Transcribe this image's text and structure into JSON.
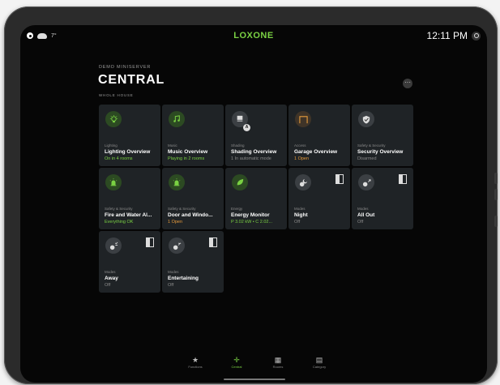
{
  "status_bar": {
    "temperature": "7°",
    "brand": "LOXONE",
    "time": "12:11 PM"
  },
  "header": {
    "server": "DEMO MINISERVER",
    "title": "CENTRAL",
    "subtitle": "WHOLE HOUSE",
    "more_label": "···"
  },
  "tiles": [
    {
      "category": "Lighting",
      "name": "Lighting Overview",
      "status": "On in 4 rooms",
      "icon": "lightbulb-icon",
      "status_color": "green"
    },
    {
      "category": "Music",
      "name": "Music Overview",
      "status": "Playing in 2 rooms",
      "icon": "music-note-icon",
      "status_color": "green"
    },
    {
      "category": "Shading",
      "name": "Shading Overview",
      "status": "1 In automatic mode",
      "icon": "blind-icon",
      "status_color": "gray",
      "badge": "A"
    },
    {
      "category": "Access",
      "name": "Garage Overview",
      "status": "1 Open",
      "icon": "garage-door-icon",
      "status_color": "orange"
    },
    {
      "category": "Safety & Security",
      "name": "Security Overview",
      "status": "Disarmed",
      "icon": "shield-icon",
      "status_color": "gray"
    },
    {
      "category": "Safety & Security",
      "name": "Fire and Water Al...",
      "status": "Everything OK",
      "icon": "siren-icon",
      "status_color": "green"
    },
    {
      "category": "Safety & Security",
      "name": "Door and Windo...",
      "status": "1 Open",
      "icon": "siren-icon",
      "status_color": "orange"
    },
    {
      "category": "Energy",
      "name": "Energy Monitor",
      "status": "P 3.02 kW • C 2.02...",
      "icon": "leaf-icon",
      "status_color": "green"
    },
    {
      "category": "Modes",
      "name": "Night",
      "status": "Off",
      "icon": "moon-mode-icon",
      "status_color": "gray",
      "toggle": true
    },
    {
      "category": "Modes",
      "name": "All Out",
      "status": "Off",
      "icon": "leave-mode-icon",
      "status_color": "gray",
      "toggle": true
    },
    {
      "category": "Modes",
      "name": "Away",
      "status": "Off",
      "icon": "away-mode-icon",
      "status_color": "gray",
      "toggle": true
    },
    {
      "category": "Modes",
      "name": "Entertaining",
      "status": "Off",
      "icon": "party-mode-icon",
      "status_color": "gray",
      "toggle": true
    }
  ],
  "bottom_nav": [
    {
      "label": "Functions",
      "icon": "star-icon",
      "glyph": "★",
      "active": false
    },
    {
      "label": "Central",
      "icon": "central-icon",
      "glyph": "✛",
      "active": true
    },
    {
      "label": "Rooms",
      "icon": "grid-icon",
      "glyph": "▦",
      "active": false
    },
    {
      "label": "Category",
      "icon": "category-icon",
      "glyph": "▤",
      "active": false
    }
  ],
  "colors": {
    "accent": "#7ad143",
    "tile_bg": "#1f2326",
    "screen_bg": "#060606",
    "warning": "#e69b3c"
  }
}
